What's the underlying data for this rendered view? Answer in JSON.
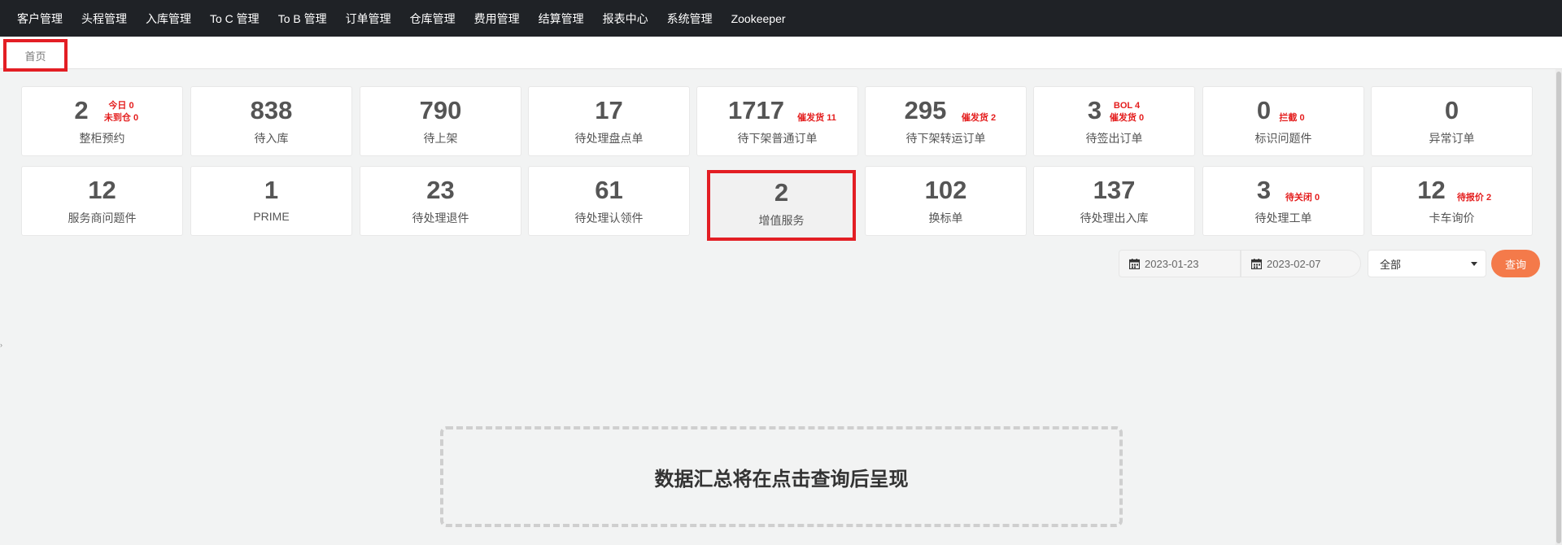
{
  "topnav": {
    "items": [
      "客户管理",
      "头程管理",
      "入库管理",
      "To C 管理",
      "To B 管理",
      "订单管理",
      "仓库管理",
      "费用管理",
      "结算管理",
      "报表中心",
      "系统管理",
      "Zookeeper"
    ]
  },
  "tabs": {
    "home": "首页"
  },
  "cards_row1": [
    {
      "value": "2",
      "label": "整柜预约",
      "badge1": "今日 0",
      "badge2": "未到仓 0"
    },
    {
      "value": "838",
      "label": "待入库"
    },
    {
      "value": "790",
      "label": "待上架"
    },
    {
      "value": "17",
      "label": "待处理盘点单"
    },
    {
      "value": "1717",
      "label": "待下架普通订单",
      "badge1": "催发货 11"
    },
    {
      "value": "295",
      "label": "待下架转运订单",
      "badge1": "催发货 2"
    },
    {
      "value": "3",
      "label": "待签出订单",
      "badge1": "BOL 4",
      "badge2": "催发货 0"
    },
    {
      "value": "0",
      "label": "标识问题件",
      "badge1": "拦截 0"
    },
    {
      "value": "0",
      "label": "异常订单"
    }
  ],
  "cards_row2": [
    {
      "value": "12",
      "label": "服务商问题件"
    },
    {
      "value": "1",
      "label": "PRIME"
    },
    {
      "value": "23",
      "label": "待处理退件"
    },
    {
      "value": "61",
      "label": "待处理认领件"
    },
    {
      "value": "2",
      "label": "增值服务"
    },
    {
      "value": "102",
      "label": "换标单"
    },
    {
      "value": "137",
      "label": "待处理出入库"
    },
    {
      "value": "3",
      "label": "待处理工单",
      "badge1": "待关闭 0"
    },
    {
      "value": "12",
      "label": "卡车询价",
      "badge1": "待报价 2"
    }
  ],
  "filters": {
    "start_date": "2023-01-23",
    "end_date": "2023-02-07",
    "select_value": "全部",
    "query_label": "查询"
  },
  "summary": {
    "text": "数据汇总将在点击查询后呈现"
  },
  "colors": {
    "nav_bg": "#1f2226",
    "accent": "#f47a4a",
    "badge": "#e41d1d",
    "highlight": "#e31e24"
  }
}
